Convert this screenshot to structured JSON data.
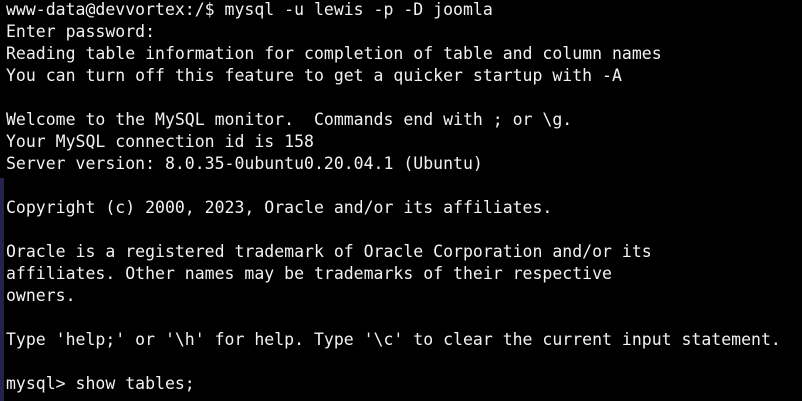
{
  "terminal": {
    "colors": {
      "background": "#000000",
      "foreground": "#f2f2f2",
      "edge_bar": "#23234e"
    },
    "lines": [
      "www-data@devvortex:/$ mysql -u lewis -p -D joomla",
      "Enter password:",
      "Reading table information for completion of table and column names",
      "You can turn off this feature to get a quicker startup with -A",
      "",
      "Welcome to the MySQL monitor.  Commands end with ; or \\g.",
      "Your MySQL connection id is 158",
      "Server version: 8.0.35-0ubuntu0.20.04.1 (Ubuntu)",
      "",
      "Copyright (c) 2000, 2023, Oracle and/or its affiliates.",
      "",
      "Oracle is a registered trademark of Oracle Corporation and/or its",
      "affiliates. Other names may be trademarks of their respective",
      "owners.",
      "",
      "Type 'help;' or '\\h' for help. Type '\\c' to clear the current input statement.",
      "",
      "mysql> show tables;"
    ]
  }
}
